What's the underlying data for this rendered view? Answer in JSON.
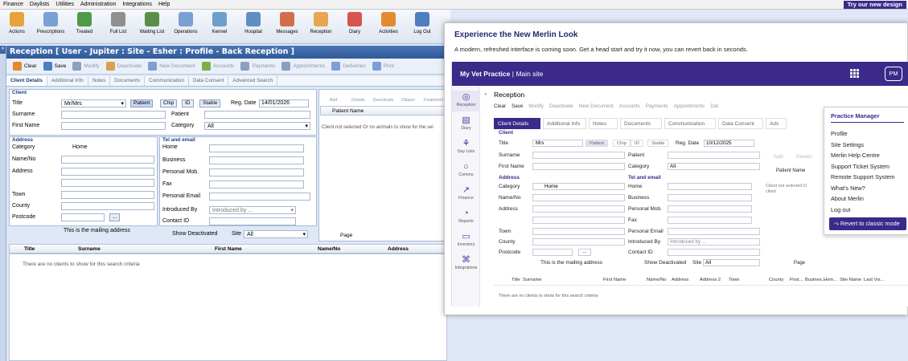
{
  "menubar": {
    "items": [
      "Finance",
      "Daylists",
      "Utilities",
      "Administration",
      "Integrations",
      "Help"
    ],
    "try_button": "Try our new design"
  },
  "toolbar": {
    "buttons": [
      {
        "label": "Actions",
        "icon": "clipboard-icon",
        "color": "#e8a23b"
      },
      {
        "label": "Prescriptions",
        "icon": "pills-icon",
        "color": "#7aa0d4"
      },
      {
        "label": "Treated",
        "icon": "treated-icon",
        "color": "#4f9a4a"
      },
      {
        "label": "Full List",
        "icon": "list-icon",
        "color": "#8f8f8f"
      },
      {
        "label": "Waiting List",
        "icon": "waiting-icon",
        "color": "#5a8f4a"
      },
      {
        "label": "Operations",
        "icon": "operations-icon",
        "color": "#7aa0d4"
      },
      {
        "label": "Kennel",
        "icon": "kennel-icon",
        "color": "#6d9fc9"
      },
      {
        "label": "Hospital",
        "icon": "hospital-icon",
        "color": "#5e8fc0"
      },
      {
        "label": "Messages",
        "icon": "messages-icon",
        "color": "#d46e4a"
      },
      {
        "label": "Reception",
        "icon": "reception-icon",
        "color": "#e9a54f"
      },
      {
        "label": "Diary",
        "icon": "diary-icon",
        "color": "#d9534f"
      },
      {
        "label": "Activities",
        "icon": "activities-icon",
        "color": "#e38a2f"
      },
      {
        "label": "Log Out",
        "icon": "logout-icon",
        "color": "#4f7ec0"
      }
    ]
  },
  "reception": {
    "title": "Reception [ User - Jupiter : Site - Esher : Profile - Back Reception ]",
    "actions": [
      "Clear",
      "Save",
      "Modify",
      "Deactivate",
      "New Document",
      "Accounts",
      "Payments",
      "Appointments",
      "Deliveries",
      "Print"
    ],
    "tabs": [
      "Client Details",
      "Additional Info",
      "Notes",
      "Documents",
      "Communication",
      "Data Consent",
      "Advanced Search"
    ],
    "client": {
      "legend": "Client",
      "title_label": "Title",
      "title_value": "Mr/Mrs",
      "type_buttons": [
        "Patient",
        "Chip",
        "ID",
        "Stable"
      ],
      "reg_label": "Reg. Date",
      "reg_value": "14/01/2026",
      "surname": "Surname",
      "first_name": "First Name",
      "patient": "Patient",
      "category": "Category",
      "category_value": "All"
    },
    "address": {
      "legend": "Address",
      "category": "Category",
      "category_value": "Home",
      "name_no": "Name/No",
      "address": "Address",
      "town": "Town",
      "county": "County",
      "postcode": "Postcode",
      "postcode_btn": "...",
      "mailing": "This is the mailing address"
    },
    "tel": {
      "legend": "Tel and email",
      "home": "Home",
      "business": "Business",
      "personal_mob": "Personal Mob.",
      "fax": "Fax",
      "personal_email": "Personal Email",
      "introduced_by": "Introduced By",
      "introduced_placeholder": "Introduced by ...",
      "contact_id": "Contact ID",
      "show_deactivated": "Show Deactivated",
      "site": "Site",
      "site_value": "All"
    },
    "patient_panel": {
      "buttons": [
        "Add",
        "Details",
        "Deactivate",
        "Clipper",
        "Treatment"
      ],
      "header": "Patient Name",
      "empty": "Client not selected Or no animals to show for the sel",
      "page": "Page"
    },
    "grid": {
      "headers": [
        "Title",
        "Surname",
        "First Name",
        "Name/No",
        "Address"
      ],
      "empty": "There are no clients to show for this search criteria"
    }
  },
  "modal": {
    "title": "Experience the New Merlin Look",
    "description": "A modern, refreshed interface is coming soon. Get a head start and try it now, you can revert back in seconds.",
    "practice": "My Vet Practice",
    "site": "Main site",
    "avatar": "PM",
    "nav": [
      {
        "label": "Reception",
        "glyph": "◎"
      },
      {
        "label": "Diary",
        "glyph": "▤"
      },
      {
        "label": "Day Lists",
        "glyph": "⚘"
      },
      {
        "label": "Comms",
        "glyph": "○"
      },
      {
        "label": "Finance",
        "glyph": "↗"
      },
      {
        "label": "Reports",
        "glyph": "◔"
      },
      {
        "label": "Inventory",
        "glyph": "▭"
      },
      {
        "label": "Integrations",
        "glyph": "⌘"
      }
    ],
    "reception_title": "Reception",
    "actions": [
      "Clear",
      "Save",
      "Modify",
      "Deactivate",
      "New Document",
      "Accounts",
      "Payments",
      "Appointments",
      "Dat"
    ],
    "tabs": [
      "Client Details",
      "Additional Info",
      "Notes",
      "Documents",
      "Communication",
      "Data Consent",
      "Adv"
    ],
    "client": {
      "legend": "Client",
      "title": "Title",
      "title_value": "Mrs",
      "types": [
        "Patient",
        "Chip",
        "ID",
        "Stable"
      ],
      "reg": "Reg. Date",
      "reg_value": "10/12/2025",
      "surname": "Surname",
      "patient": "Patient",
      "first_name": "First Name",
      "category": "Category",
      "category_value": "All"
    },
    "address": {
      "legend": "Address",
      "category": "Category",
      "category_value": "Home",
      "name_no": "Name/No",
      "address": "Address",
      "town": "Town",
      "county": "County",
      "postcode": "Postcode",
      "postcode_btn": "...",
      "mailing": "This is the mailing address"
    },
    "tel": {
      "legend": "Tel and email",
      "home": "Home",
      "business": "Business",
      "personal_mob": "Personal Mob.",
      "fax": "Fax",
      "personal_email": "Personal Email",
      "introduced_by": "Introduced By",
      "introduced_placeholder": "Introduced by ...",
      "contact_id": "Contact ID",
      "show_deactivated": "Show Deactivated",
      "site": "Site",
      "site_value": "All"
    },
    "patient_panel": {
      "buttons": [
        "Add",
        "Details"
      ],
      "header": "Patient Name",
      "empty_1": "Client not selected O",
      "empty_2": "client",
      "page": "Page"
    },
    "grid": {
      "headers": [
        "Title",
        "Surname",
        "First Name",
        "Name/No",
        "Address",
        "Address 2",
        "Town",
        "County",
        "Post...",
        "Busines...",
        "Hom...",
        "Site Name",
        "Last Vis..."
      ],
      "empty": "There are no clients to show for this search criteria"
    },
    "dropdown": {
      "header": "Practice Manager",
      "items": [
        "Profile",
        "Site Settings",
        "Merlin Help Centre",
        "Support Ticket System",
        "Remote Support System",
        "What's New?",
        "About Merlin",
        "Log out"
      ],
      "revert": "Revert to classic mode"
    }
  },
  "colors": {
    "brand": "#3b2a8a",
    "classic_title": "#2f5a99"
  }
}
